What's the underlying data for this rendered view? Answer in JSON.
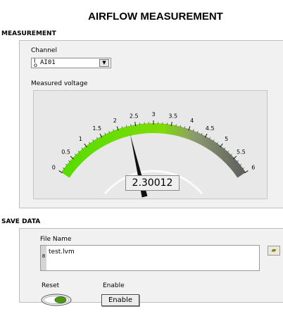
{
  "title": "AIRFLOW MEASUREMENT",
  "measurement": {
    "header": "MEASUREMENT",
    "channel_label": "Channel",
    "channel_value": "AI01",
    "voltage_label": "Measured voltage",
    "scale_labels": [
      "0",
      "0.5",
      "1",
      "1.5",
      "2",
      "2.5",
      "3",
      "3.5",
      "4",
      "4.5",
      "5",
      "5.5",
      "6"
    ],
    "scale_min": 0,
    "scale_max": 6,
    "reading": "2.30012",
    "reading_value": 2.30012
  },
  "save": {
    "header": "SAVE DATA",
    "file_label": "File Name",
    "file_value": "test.lvm",
    "reset_label": "Reset",
    "enable_label": "Enable",
    "enable_button": "Enable"
  },
  "colors": {
    "gauge_active": "#66dd00",
    "gauge_inactive": "#6b6b6b",
    "reset_led": "#4a9a16"
  }
}
